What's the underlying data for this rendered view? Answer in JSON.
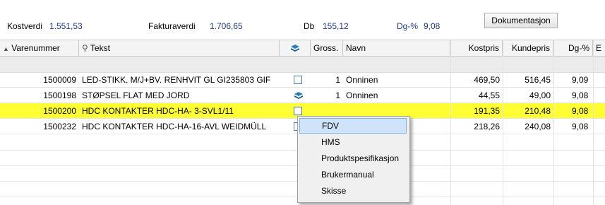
{
  "summary": {
    "kostverdi_label": "Kostverdi",
    "kostverdi_value": "1.551,53",
    "fakturaverdi_label": "Fakturaverdi",
    "fakturaverdi_value": "1.706,65",
    "db_label": "Db",
    "db_value": "155,12",
    "dg_label": "Dg-%",
    "dg_value": "9,08",
    "doc_button": "Dokumentasjon"
  },
  "columns": {
    "varenummer": "Varenummer",
    "tekst": "Tekst",
    "gross": "Gross.",
    "navn": "Navn",
    "kostpris": "Kostpris",
    "kundepris": "Kundepris",
    "dg": "Dg-%",
    "extra": "E"
  },
  "icons": {
    "sort": "sort-ascending-icon",
    "search": "search-icon",
    "doc": "document-icon"
  },
  "colors": {
    "selected_row": "#ffff33",
    "value_text": "#1f3a8a",
    "menu_highlight": "#cfe4fb"
  },
  "rows": [
    {
      "varenummer": "1500009",
      "tekst": "LED-STIKK. M/J+BV. RENHVIT GL GI235803 GIF",
      "icon": "checkbox",
      "gross": "1",
      "navn": "Onninen",
      "kostpris": "469,50",
      "kundepris": "516,45",
      "dg": "9,09"
    },
    {
      "varenummer": "1500198",
      "tekst": "STØPSEL FLAT MED JORD",
      "icon": "doc",
      "gross": "1",
      "navn": "Onninen",
      "kostpris": "44,55",
      "kundepris": "49,00",
      "dg": "9,08"
    },
    {
      "varenummer": "1500200",
      "tekst": "HDC KONTAKTER HDC-HA- 3-SVL1/11",
      "icon": "checkbox",
      "gross": "",
      "navn": "",
      "kostpris": "191,35",
      "kundepris": "210,48",
      "dg": "9,08"
    },
    {
      "varenummer": "1500232",
      "tekst": "HDC KONTAKTER HDC-HA-16-AVL WEIDMÜLL",
      "icon": "checkbox",
      "gross": "",
      "navn": "",
      "kostpris": "218,26",
      "kundepris": "240,08",
      "dg": "9,08"
    }
  ],
  "context_menu": [
    "FDV",
    "HMS",
    "Produktspesifikasjon",
    "Brukermanual",
    "Skisse"
  ]
}
